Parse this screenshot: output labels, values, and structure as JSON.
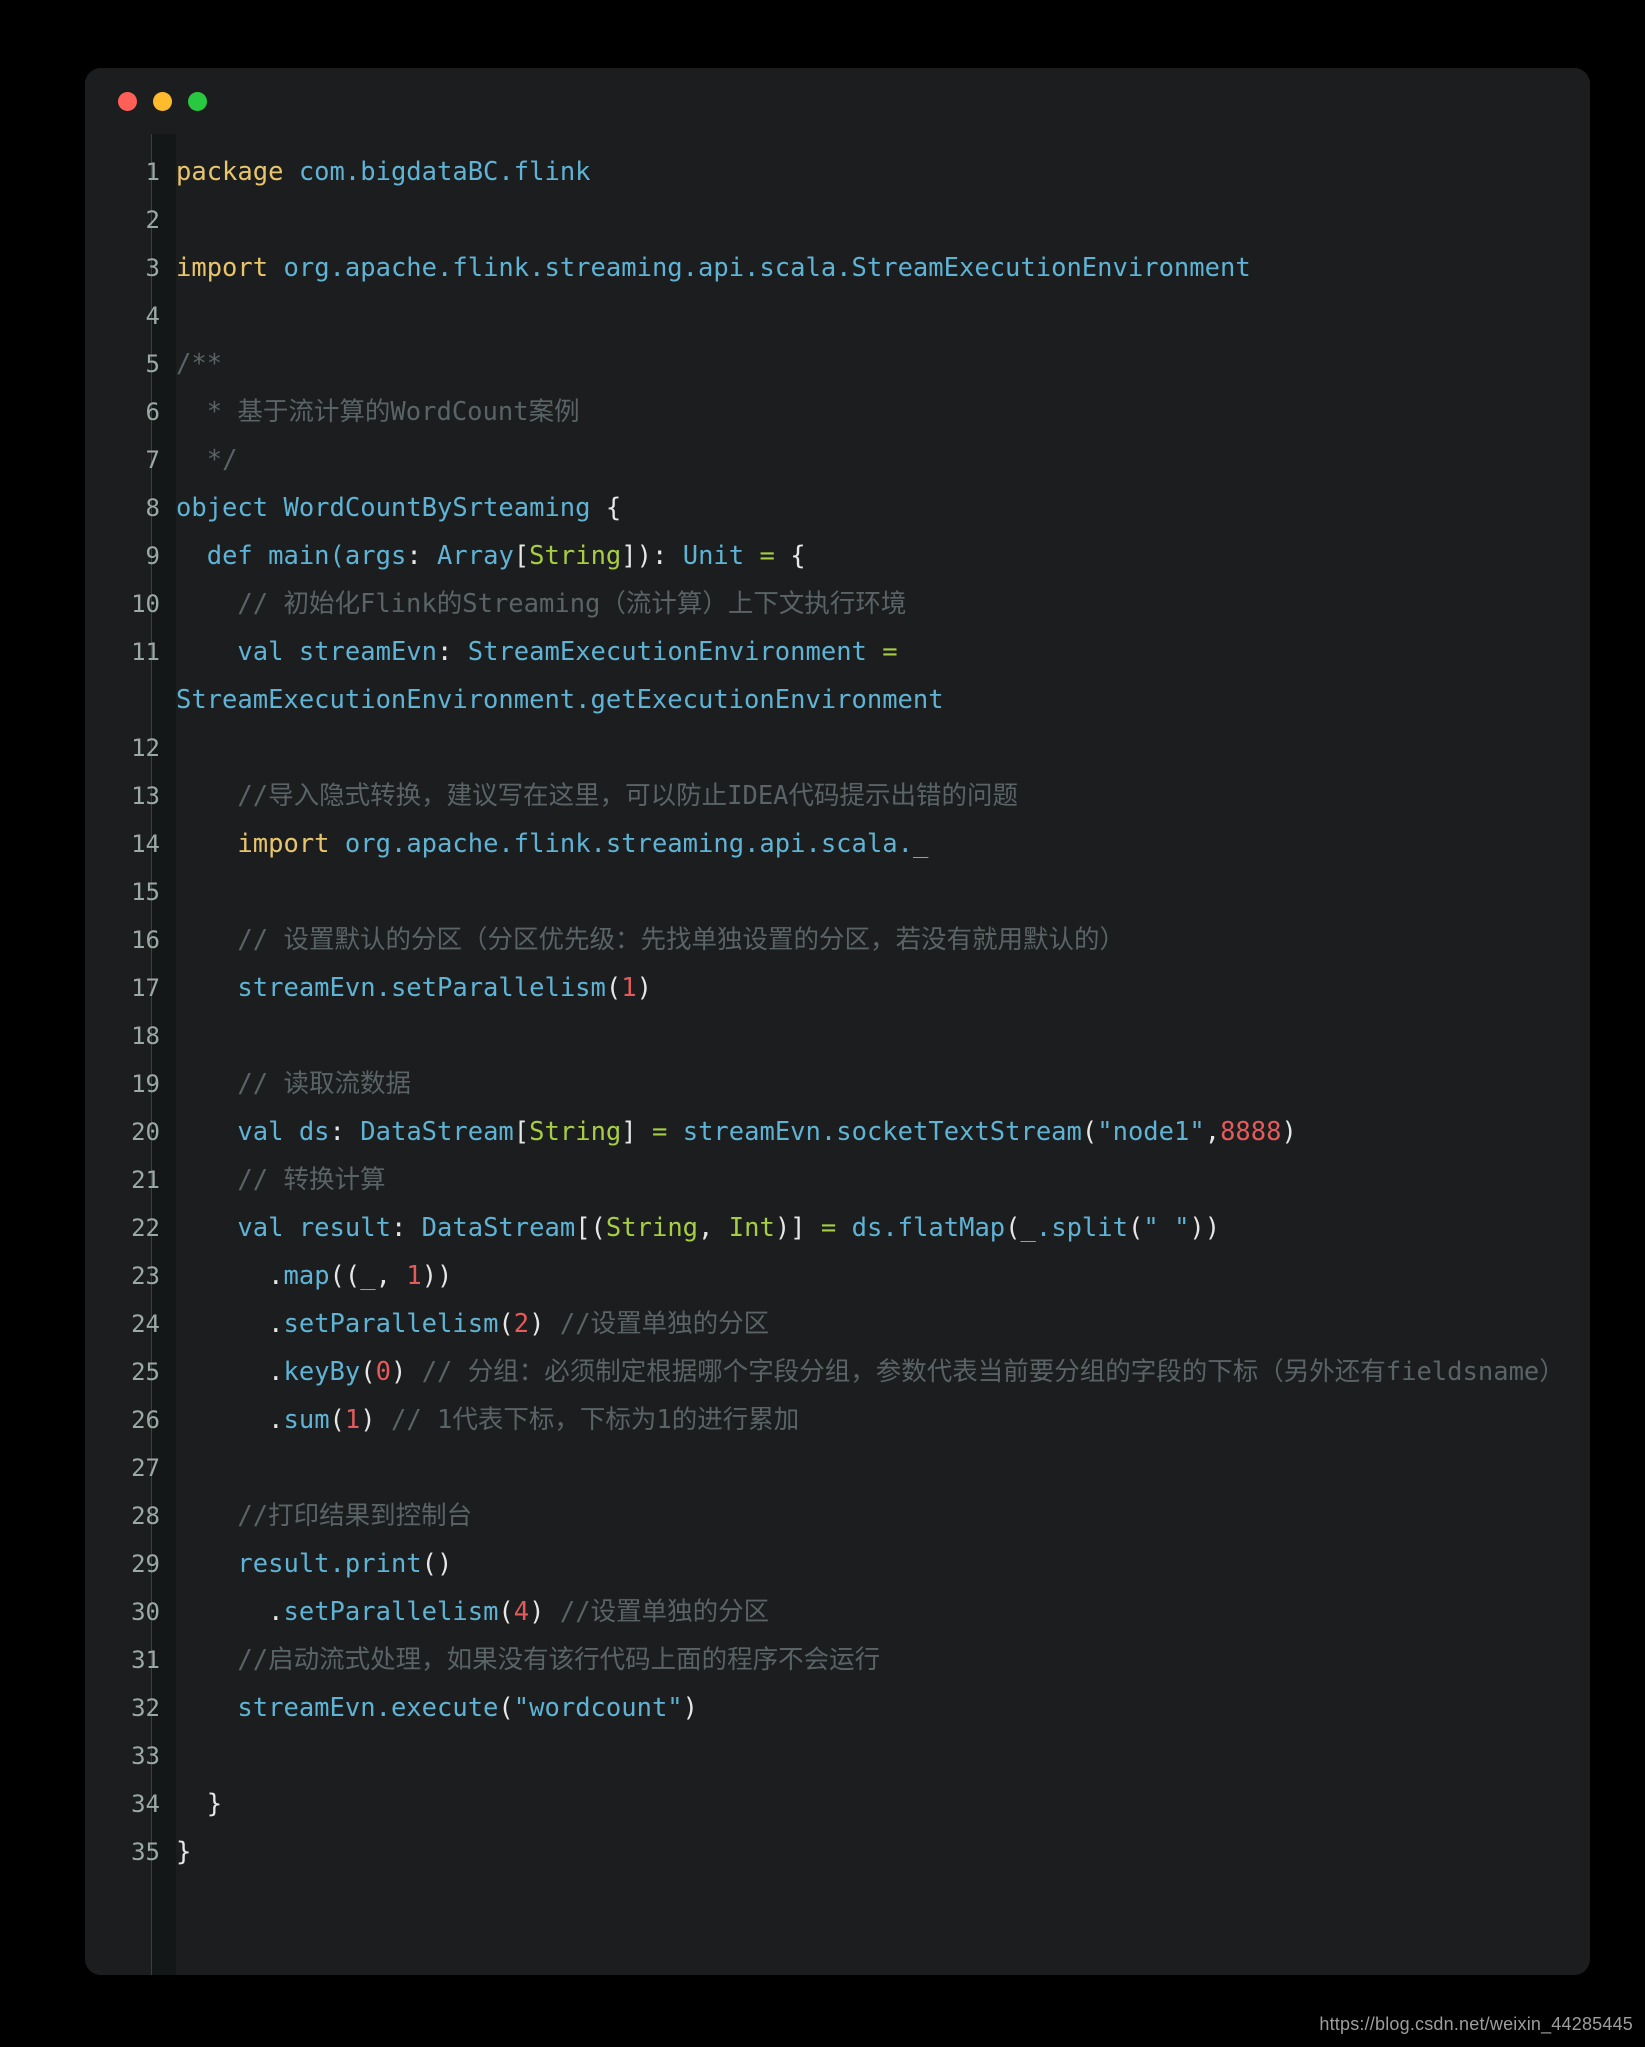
{
  "window": {
    "traffic_lights": [
      {
        "name": "close",
        "color": "#ff5f57"
      },
      {
        "name": "minimize",
        "color": "#febb2e"
      },
      {
        "name": "maximize",
        "color": "#28c840"
      }
    ],
    "background": "#1b1d1e",
    "page_background": "#000000"
  },
  "theme": {
    "keyword": "#e8c56c",
    "identifier": "#5fb3d4",
    "type": "#a6cd44",
    "operator": "#a6cd44",
    "number": "#e35b5b",
    "comment": "#5a6467",
    "punctuation": "#e6e6e6",
    "string": "#5fb3d4",
    "line_number": "#9aa9a3",
    "gutter": "#141717"
  },
  "editor": {
    "language": "scala",
    "first_line": 1,
    "last_line": 35,
    "lines": [
      {
        "n": "1",
        "tokens": [
          {
            "t": "kw",
            "v": "package"
          },
          {
            "t": "plain",
            "v": " "
          },
          {
            "t": "id",
            "v": "com.bigdataBC.flink"
          }
        ]
      },
      {
        "n": "2",
        "tokens": []
      },
      {
        "n": "3",
        "tokens": [
          {
            "t": "kw",
            "v": "import"
          },
          {
            "t": "plain",
            "v": " "
          },
          {
            "t": "id",
            "v": "org.apache.flink.streaming.api.scala.StreamExecutionEnvironment"
          }
        ]
      },
      {
        "n": "4",
        "tokens": []
      },
      {
        "n": "5",
        "tokens": [
          {
            "t": "cmt",
            "v": "/**"
          }
        ]
      },
      {
        "n": "6",
        "tokens": [
          {
            "t": "cmt",
            "v": "  * 基于流计算的WordCount案例"
          }
        ]
      },
      {
        "n": "7",
        "tokens": [
          {
            "t": "cmt",
            "v": "  */"
          }
        ]
      },
      {
        "n": "8",
        "tokens": [
          {
            "t": "id",
            "v": "object WordCountBySrteaming"
          },
          {
            "t": "plain",
            "v": " "
          },
          {
            "t": "punct",
            "v": "{"
          }
        ]
      },
      {
        "n": "9",
        "tokens": [
          {
            "t": "plain",
            "v": "  "
          },
          {
            "t": "id",
            "v": "def main(args"
          },
          {
            "t": "punct",
            "v": ":"
          },
          {
            "t": "plain",
            "v": " "
          },
          {
            "t": "id",
            "v": "Array"
          },
          {
            "t": "punct",
            "v": "["
          },
          {
            "t": "type",
            "v": "String"
          },
          {
            "t": "punct",
            "v": "])"
          },
          {
            "t": "punct",
            "v": ":"
          },
          {
            "t": "plain",
            "v": " "
          },
          {
            "t": "id",
            "v": "Unit"
          },
          {
            "t": "plain",
            "v": " "
          },
          {
            "t": "op",
            "v": "="
          },
          {
            "t": "plain",
            "v": " "
          },
          {
            "t": "punct",
            "v": "{"
          }
        ]
      },
      {
        "n": "10",
        "tokens": [
          {
            "t": "plain",
            "v": "    "
          },
          {
            "t": "cmt",
            "v": "// 初始化Flink的Streaming（流计算）上下文执行环境"
          }
        ]
      },
      {
        "n": "11",
        "tokens": [
          {
            "t": "plain",
            "v": "    "
          },
          {
            "t": "id",
            "v": "val streamEvn"
          },
          {
            "t": "punct",
            "v": ":"
          },
          {
            "t": "plain",
            "v": " "
          },
          {
            "t": "id",
            "v": "StreamExecutionEnvironment"
          },
          {
            "t": "plain",
            "v": " "
          },
          {
            "t": "op",
            "v": "="
          },
          {
            "t": "plain",
            "v": " "
          },
          {
            "t": "id",
            "v": "StreamExecutionEnvironment.getExecutionEnvironment"
          }
        ]
      },
      {
        "n": "12",
        "tokens": []
      },
      {
        "n": "13",
        "tokens": [
          {
            "t": "plain",
            "v": "    "
          },
          {
            "t": "cmt",
            "v": "//导入隐式转换，建议写在这里，可以防止IDEA代码提示出错的问题"
          }
        ]
      },
      {
        "n": "14",
        "tokens": [
          {
            "t": "plain",
            "v": "    "
          },
          {
            "t": "kw",
            "v": "import"
          },
          {
            "t": "plain",
            "v": " "
          },
          {
            "t": "id",
            "v": "org.apache.flink.streaming.api.scala._"
          }
        ]
      },
      {
        "n": "15",
        "tokens": []
      },
      {
        "n": "16",
        "tokens": [
          {
            "t": "plain",
            "v": "    "
          },
          {
            "t": "cmt",
            "v": "// 设置默认的分区（分区优先级：先找单独设置的分区，若没有就用默认的）"
          }
        ]
      },
      {
        "n": "17",
        "tokens": [
          {
            "t": "plain",
            "v": "    "
          },
          {
            "t": "id",
            "v": "streamEvn.setParallelism"
          },
          {
            "t": "punct",
            "v": "("
          },
          {
            "t": "num",
            "v": "1"
          },
          {
            "t": "punct",
            "v": ")"
          }
        ]
      },
      {
        "n": "18",
        "tokens": []
      },
      {
        "n": "19",
        "tokens": [
          {
            "t": "plain",
            "v": "    "
          },
          {
            "t": "cmt",
            "v": "// 读取流数据"
          }
        ]
      },
      {
        "n": "20",
        "tokens": [
          {
            "t": "plain",
            "v": "    "
          },
          {
            "t": "id",
            "v": "val ds"
          },
          {
            "t": "punct",
            "v": ":"
          },
          {
            "t": "plain",
            "v": " "
          },
          {
            "t": "id",
            "v": "DataStream"
          },
          {
            "t": "punct",
            "v": "["
          },
          {
            "t": "type",
            "v": "String"
          },
          {
            "t": "punct",
            "v": "]"
          },
          {
            "t": "plain",
            "v": " "
          },
          {
            "t": "op",
            "v": "="
          },
          {
            "t": "plain",
            "v": " "
          },
          {
            "t": "id",
            "v": "streamEvn.socketTextStream"
          },
          {
            "t": "punct",
            "v": "("
          },
          {
            "t": "str",
            "v": "\"node1\""
          },
          {
            "t": "punct",
            "v": ","
          },
          {
            "t": "num",
            "v": "8888"
          },
          {
            "t": "punct",
            "v": ")"
          }
        ]
      },
      {
        "n": "21",
        "tokens": [
          {
            "t": "plain",
            "v": "    "
          },
          {
            "t": "cmt",
            "v": "// 转换计算"
          }
        ]
      },
      {
        "n": "22",
        "tokens": [
          {
            "t": "plain",
            "v": "    "
          },
          {
            "t": "id",
            "v": "val result"
          },
          {
            "t": "punct",
            "v": ":"
          },
          {
            "t": "plain",
            "v": " "
          },
          {
            "t": "id",
            "v": "DataStream"
          },
          {
            "t": "punct",
            "v": "[("
          },
          {
            "t": "type",
            "v": "String"
          },
          {
            "t": "punct",
            "v": ", "
          },
          {
            "t": "type",
            "v": "Int"
          },
          {
            "t": "punct",
            "v": ")]"
          },
          {
            "t": "plain",
            "v": " "
          },
          {
            "t": "op",
            "v": "="
          },
          {
            "t": "plain",
            "v": " "
          },
          {
            "t": "id",
            "v": "ds.flatMap"
          },
          {
            "t": "punct",
            "v": "("
          },
          {
            "t": "id",
            "v": "_"
          },
          {
            "t": "id",
            "v": ".split"
          },
          {
            "t": "punct",
            "v": "("
          },
          {
            "t": "str",
            "v": "\" \""
          },
          {
            "t": "punct",
            "v": "))"
          }
        ]
      },
      {
        "n": "23",
        "tokens": [
          {
            "t": "plain",
            "v": "      "
          },
          {
            "t": "punct",
            "v": "."
          },
          {
            "t": "id",
            "v": "map"
          },
          {
            "t": "punct",
            "v": "(("
          },
          {
            "t": "id",
            "v": "_"
          },
          {
            "t": "punct",
            "v": ", "
          },
          {
            "t": "num",
            "v": "1"
          },
          {
            "t": "punct",
            "v": "))"
          }
        ]
      },
      {
        "n": "24",
        "tokens": [
          {
            "t": "plain",
            "v": "      "
          },
          {
            "t": "punct",
            "v": "."
          },
          {
            "t": "id",
            "v": "setParallelism"
          },
          {
            "t": "punct",
            "v": "("
          },
          {
            "t": "num",
            "v": "2"
          },
          {
            "t": "punct",
            "v": ")"
          },
          {
            "t": "plain",
            "v": " "
          },
          {
            "t": "cmt",
            "v": "//设置单独的分区"
          }
        ]
      },
      {
        "n": "25",
        "tokens": [
          {
            "t": "plain",
            "v": "      "
          },
          {
            "t": "punct",
            "v": "."
          },
          {
            "t": "id",
            "v": "keyBy"
          },
          {
            "t": "punct",
            "v": "("
          },
          {
            "t": "num",
            "v": "0"
          },
          {
            "t": "punct",
            "v": ")"
          },
          {
            "t": "plain",
            "v": " "
          },
          {
            "t": "cmt",
            "v": "// 分组：必须制定根据哪个字段分组，参数代表当前要分组的字段的下标（另外还有fieldsname）"
          }
        ]
      },
      {
        "n": "26",
        "tokens": [
          {
            "t": "plain",
            "v": "      "
          },
          {
            "t": "punct",
            "v": "."
          },
          {
            "t": "id",
            "v": "sum"
          },
          {
            "t": "punct",
            "v": "("
          },
          {
            "t": "num",
            "v": "1"
          },
          {
            "t": "punct",
            "v": ")"
          },
          {
            "t": "plain",
            "v": " "
          },
          {
            "t": "cmt",
            "v": "// 1代表下标，下标为1的进行累加"
          }
        ]
      },
      {
        "n": "27",
        "tokens": []
      },
      {
        "n": "28",
        "tokens": [
          {
            "t": "plain",
            "v": "    "
          },
          {
            "t": "cmt",
            "v": "//打印结果到控制台"
          }
        ]
      },
      {
        "n": "29",
        "tokens": [
          {
            "t": "plain",
            "v": "    "
          },
          {
            "t": "id",
            "v": "result.print"
          },
          {
            "t": "punct",
            "v": "()"
          }
        ]
      },
      {
        "n": "30",
        "tokens": [
          {
            "t": "plain",
            "v": "      "
          },
          {
            "t": "punct",
            "v": "."
          },
          {
            "t": "id",
            "v": "setParallelism"
          },
          {
            "t": "punct",
            "v": "("
          },
          {
            "t": "num",
            "v": "4"
          },
          {
            "t": "punct",
            "v": ")"
          },
          {
            "t": "plain",
            "v": " "
          },
          {
            "t": "cmt",
            "v": "//设置单独的分区"
          }
        ]
      },
      {
        "n": "31",
        "tokens": [
          {
            "t": "plain",
            "v": "    "
          },
          {
            "t": "cmt",
            "v": "//启动流式处理，如果没有该行代码上面的程序不会运行"
          }
        ]
      },
      {
        "n": "32",
        "tokens": [
          {
            "t": "plain",
            "v": "    "
          },
          {
            "t": "id",
            "v": "streamEvn.execute"
          },
          {
            "t": "punct",
            "v": "("
          },
          {
            "t": "str",
            "v": "\"wordcount\""
          },
          {
            "t": "punct",
            "v": ")"
          }
        ]
      },
      {
        "n": "33",
        "tokens": []
      },
      {
        "n": "34",
        "tokens": [
          {
            "t": "plain",
            "v": "  "
          },
          {
            "t": "punct",
            "v": "}"
          }
        ]
      },
      {
        "n": "35",
        "tokens": [
          {
            "t": "punct",
            "v": "}"
          }
        ]
      }
    ]
  },
  "watermark": {
    "text": "https://blog.csdn.net/weixin_44285445"
  }
}
